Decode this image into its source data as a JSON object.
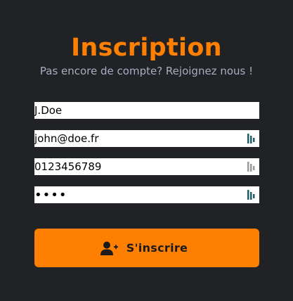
{
  "header": {
    "title": "Inscription",
    "subtitle": "Pas encore de compte? Rejoignez nous !"
  },
  "form": {
    "username_value": "J.Doe",
    "email_value": "john@doe.fr",
    "phone_value": "0123456789",
    "password_value": "abcd",
    "submit_label": "S'inscrire",
    "submit_icon": "user-plus-icon"
  },
  "colors": {
    "background": "#212226",
    "accent": "#ff7f00",
    "subtitle": "#a7aec0",
    "field_background": "#ffffff",
    "password_manager_active": "#1e5f66",
    "password_manager_inactive": "#9a9a9a"
  }
}
